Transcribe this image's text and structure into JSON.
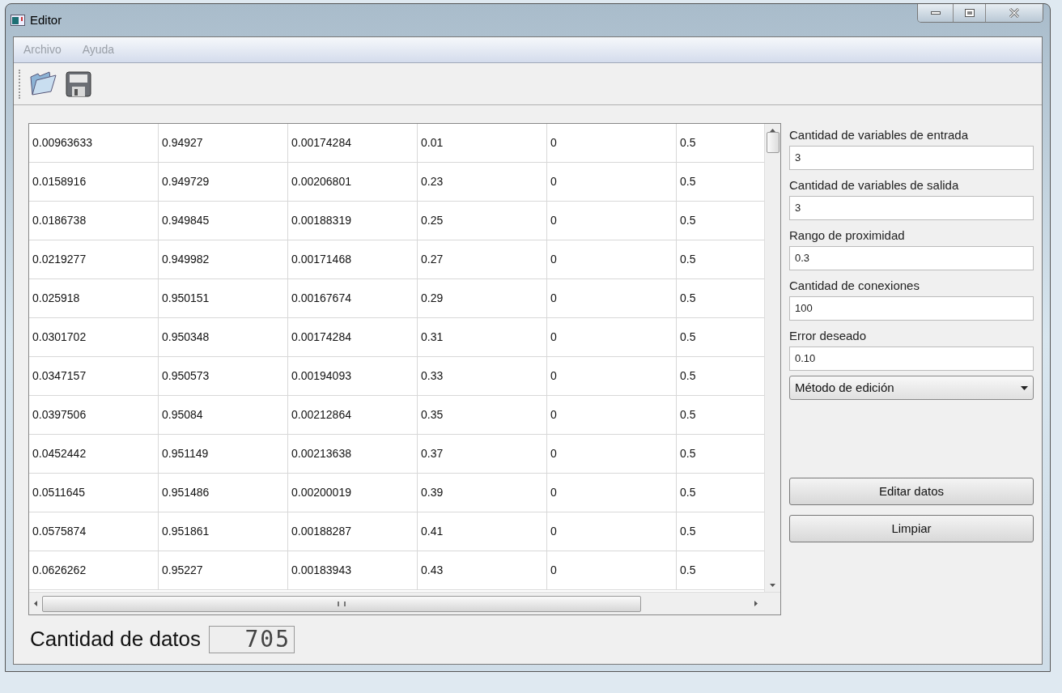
{
  "window": {
    "title": "Editor"
  },
  "menu": [
    "Archivo",
    "Ayuda"
  ],
  "table": {
    "rows": [
      [
        "0.00963633",
        "0.94927",
        "0.00174284",
        "0.01",
        "0",
        "0.5"
      ],
      [
        "0.0158916",
        "0.949729",
        "0.00206801",
        "0.23",
        "0",
        "0.5"
      ],
      [
        "0.0186738",
        "0.949845",
        "0.00188319",
        "0.25",
        "0",
        "0.5"
      ],
      [
        "0.0219277",
        "0.949982",
        "0.00171468",
        "0.27",
        "0",
        "0.5"
      ],
      [
        "0.025918",
        "0.950151",
        "0.00167674",
        "0.29",
        "0",
        "0.5"
      ],
      [
        "0.0301702",
        "0.950348",
        "0.00174284",
        "0.31",
        "0",
        "0.5"
      ],
      [
        "0.0347157",
        "0.950573",
        "0.00194093",
        "0.33",
        "0",
        "0.5"
      ],
      [
        "0.0397506",
        "0.95084",
        "0.00212864",
        "0.35",
        "0",
        "0.5"
      ],
      [
        "0.0452442",
        "0.951149",
        "0.00213638",
        "0.37",
        "0",
        "0.5"
      ],
      [
        "0.0511645",
        "0.951486",
        "0.00200019",
        "0.39",
        "0",
        "0.5"
      ],
      [
        "0.0575874",
        "0.951861",
        "0.00188287",
        "0.41",
        "0",
        "0.5"
      ],
      [
        "0.0626262",
        "0.95227",
        "0.00183943",
        "0.43",
        "0",
        "0.5"
      ]
    ]
  },
  "fields": [
    {
      "label": "Cantidad de variables de entrada",
      "value": "3"
    },
    {
      "label": "Cantidad de variables de salida",
      "value": "3"
    },
    {
      "label": "Rango de proximidad",
      "value": "0.3"
    },
    {
      "label": "Cantidad de conexiones",
      "value": "100"
    },
    {
      "label": "Error deseado",
      "value": "0.10"
    }
  ],
  "method_dropdown": {
    "value": "Método de edición"
  },
  "buttons": [
    "Editar datos",
    "Limpiar"
  ],
  "data_count": {
    "label": "Cantidad de datos",
    "value": "705"
  }
}
